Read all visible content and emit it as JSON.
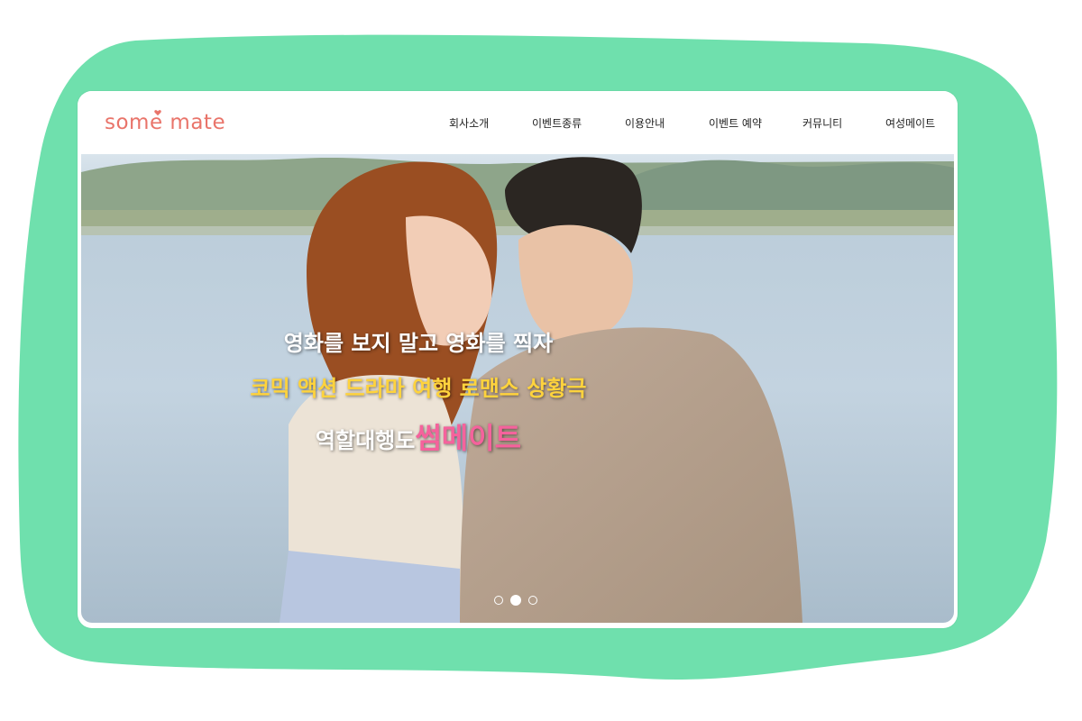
{
  "brand": {
    "logo_text": "some mate",
    "logo_color": "#e9746a",
    "background_blob_color": "#6fe0ad"
  },
  "nav": {
    "items": [
      {
        "label": "회사소개"
      },
      {
        "label": "이벤트종류"
      },
      {
        "label": "이용안내"
      },
      {
        "label": "이벤트 예약"
      },
      {
        "label": "커뮤니티"
      },
      {
        "label": "여성메이트"
      }
    ]
  },
  "hero": {
    "line1": "영화를 보지 말고 영화를 찍자",
    "line2": "코믹 액션 드라마 여행 로맨스 상황극",
    "line3_prefix": "역할대행도",
    "line3_highlight": "썸메이트",
    "line2_color": "#ffd33d",
    "highlight_color": "#f5629c",
    "image_icon": "couple-lakeside-photo"
  },
  "carousel": {
    "slide_count": 3,
    "active_index": 1
  }
}
